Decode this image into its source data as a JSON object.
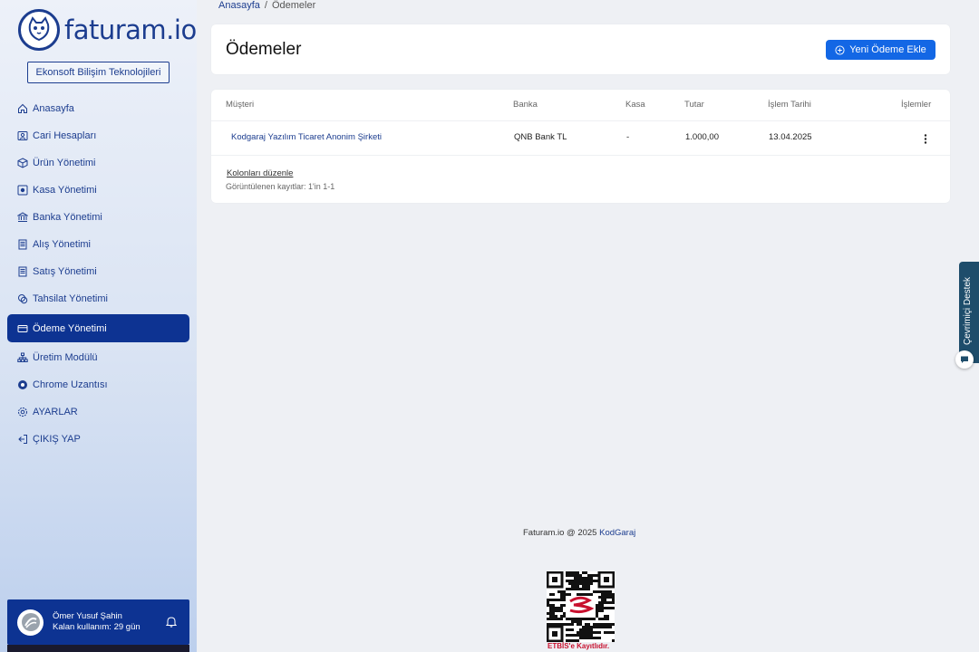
{
  "brand": {
    "logo_text": "faturam.io"
  },
  "sidebar": {
    "company": "Ekonsoft Bilişim Teknolojileri",
    "items": [
      {
        "label": "Anasayfa",
        "icon": "home-icon"
      },
      {
        "label": "Cari Hesapları",
        "icon": "user-card-icon"
      },
      {
        "label": "Ürün Yönetimi",
        "icon": "box-icon"
      },
      {
        "label": "Kasa Yönetimi",
        "icon": "safe-icon"
      },
      {
        "label": "Banka Yönetimi",
        "icon": "bank-icon"
      },
      {
        "label": "Alış Yönetimi",
        "icon": "receipt-icon"
      },
      {
        "label": "Satış Yönetimi",
        "icon": "receipt-icon"
      },
      {
        "label": "Tahsilat Yönetimi",
        "icon": "coins-icon"
      },
      {
        "label": "Ödeme Yönetimi",
        "icon": "credit-card-icon",
        "active": true
      },
      {
        "label": "Üretim Modülü",
        "icon": "sitemap-icon"
      },
      {
        "label": "Chrome Uzantısı",
        "icon": "chrome-icon"
      },
      {
        "label": "AYARLAR",
        "icon": "gear-icon"
      },
      {
        "label": "ÇIKIŞ YAP",
        "icon": "logout-icon"
      }
    ],
    "user": {
      "name": "Ömer Yusuf Şahin",
      "remaining": "Kalan kullanım: 29 gün"
    }
  },
  "breadcrumb": {
    "home": "Anasayfa",
    "separator": "/",
    "current": "Ödemeler"
  },
  "header": {
    "title": "Ödemeler",
    "add_button": "Yeni Ödeme Ekle"
  },
  "table": {
    "columns": [
      "Müşteri",
      "Banka",
      "Kasa",
      "Tutar",
      "İşlem Tarihi",
      "İşlemler"
    ],
    "rows": [
      {
        "customer": "Kodgaraj Yazılım Ticaret Anonim Şirketi",
        "bank": "QNB Bank TL",
        "cash": "-",
        "amount": "1.000,00",
        "date": "13.04.2025"
      }
    ],
    "edit_columns": "Kolonları düzenle",
    "records": "Görüntülenen kayıtlar: 1'in 1-1"
  },
  "footer": {
    "text": "Faturam.io @ 2025",
    "link": "KodGaraj",
    "etbis": "ETBİS'e Kayıtlıdır."
  },
  "support": {
    "label": "Çevrimiçi Destek"
  },
  "colors": {
    "primary": "#0d3392",
    "button": "#1367e5",
    "support": "#1e4d6b"
  }
}
